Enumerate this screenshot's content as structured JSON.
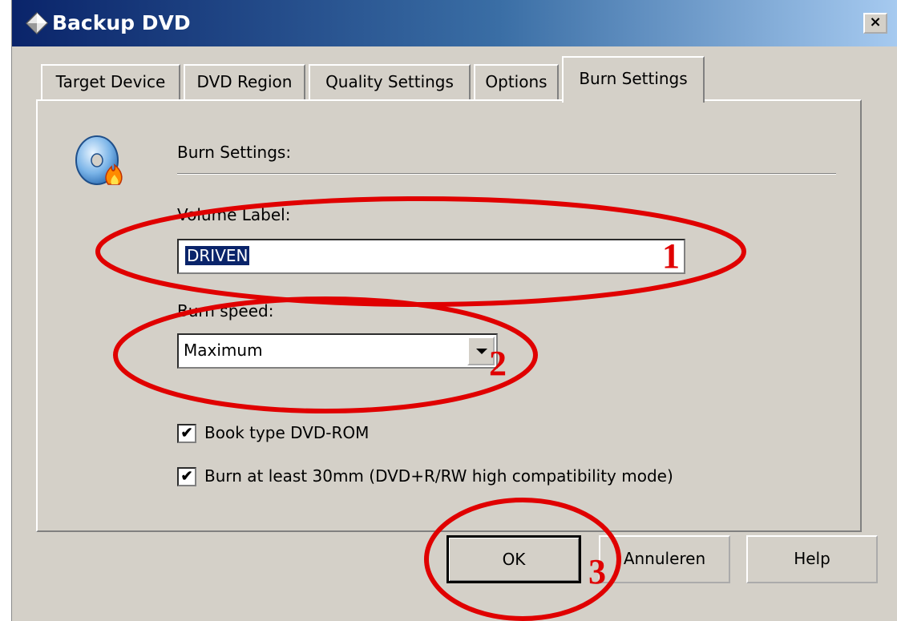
{
  "window": {
    "title": "Backup DVD",
    "close_label": "×",
    "title_icon": "diamond-app-icon"
  },
  "tabs": [
    {
      "label": "Target Device",
      "active": false
    },
    {
      "label": "DVD Region",
      "active": false
    },
    {
      "label": "Quality Settings",
      "active": false
    },
    {
      "label": "Options",
      "active": false
    },
    {
      "label": "Burn Settings",
      "active": true
    }
  ],
  "panel": {
    "icon": "burning-cd-icon",
    "section_title": "Burn Settings:",
    "volume_label": {
      "label": "Volume Label:",
      "value": "DRIVEN"
    },
    "burn_speed": {
      "label": "Burn speed:",
      "selected": "Maximum"
    },
    "checkboxes": [
      {
        "label": "Book type DVD-ROM",
        "checked": true
      },
      {
        "label": "Burn at least 30mm (DVD+R/RW high compatibility mode)",
        "checked": true
      }
    ]
  },
  "buttons": {
    "ok": "OK",
    "cancel": "Annuleren",
    "help": "Help"
  },
  "annotations": {
    "color": "#e00000",
    "markers": [
      "1",
      "2",
      "3"
    ]
  }
}
